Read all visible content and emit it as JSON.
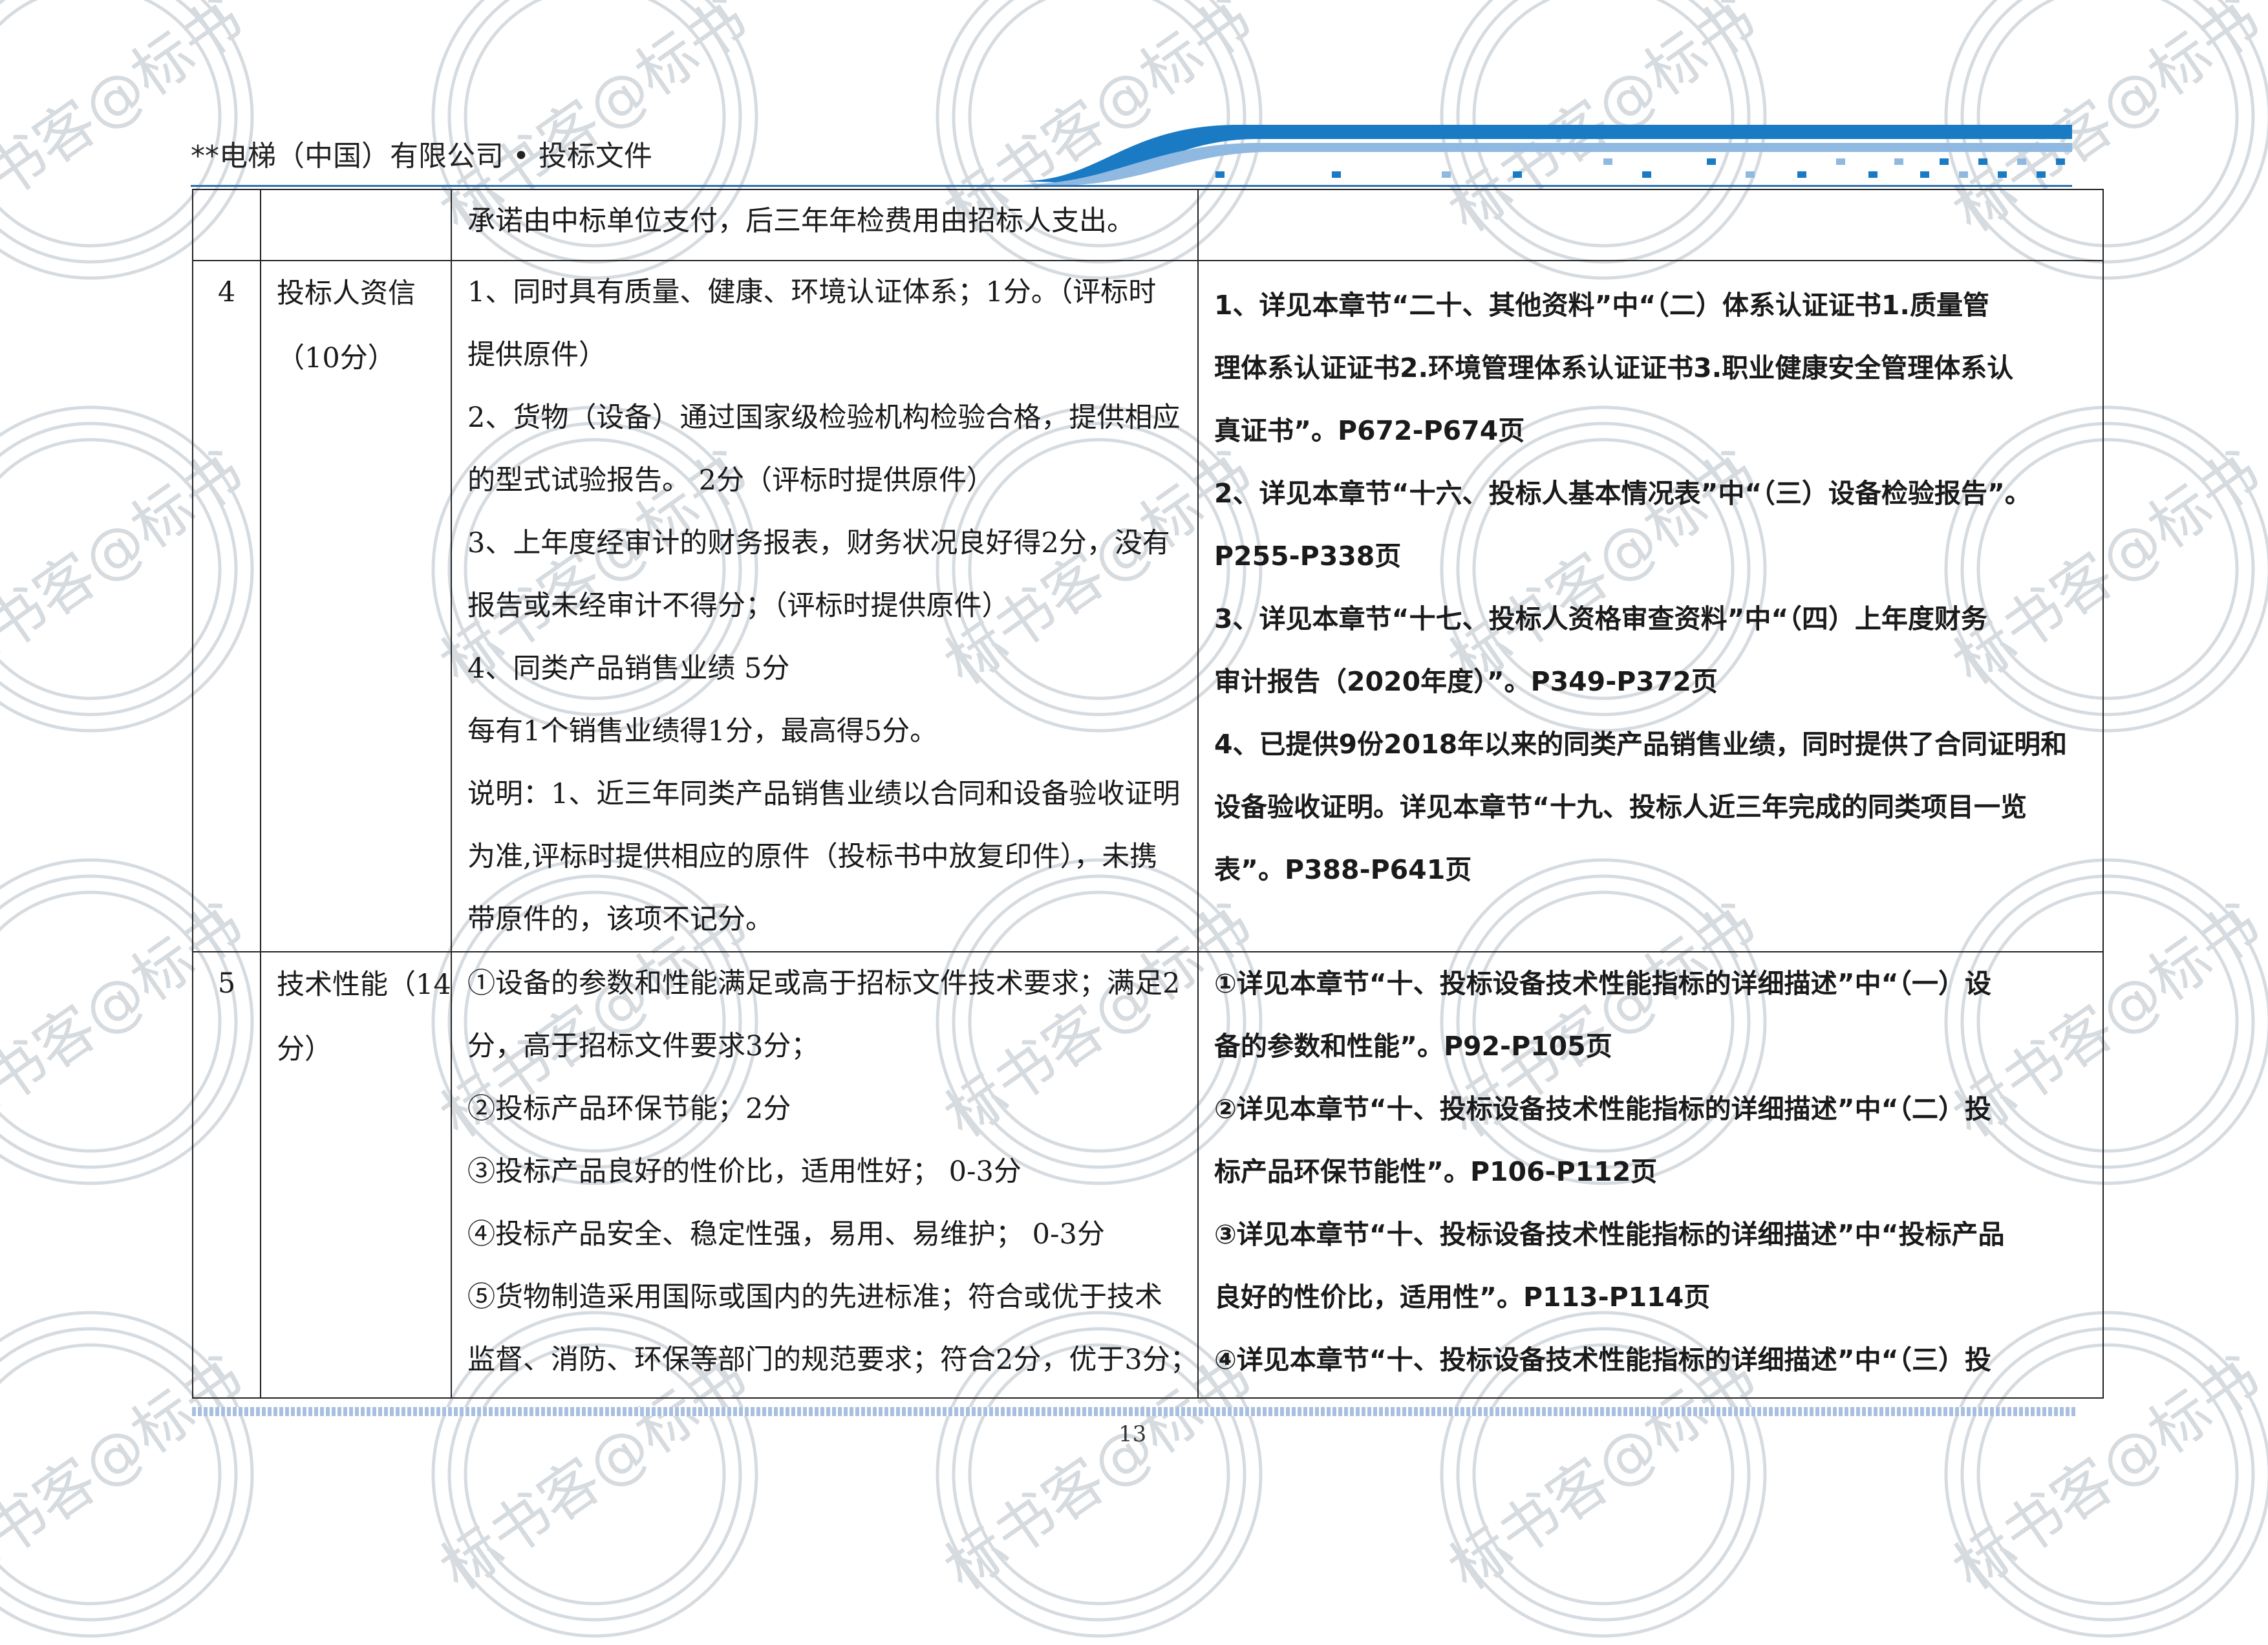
{
  "header": {
    "title": "**电梯（中国）有限公司 • 投标文件"
  },
  "watermark": {
    "text": "标书客@标书",
    "color": "#d6dbe0"
  },
  "colors": {
    "accent": "#1a7bc4",
    "accent_light": "#8fb9e0"
  },
  "table": {
    "rows": [
      {
        "num": "",
        "item": "",
        "criteria": [
          "承诺由中标单位支付，后三年年检费用由招标人支出。"
        ],
        "response": []
      },
      {
        "num": "4",
        "item": [
          "投标人资信",
          "（10分）"
        ],
        "criteria": [
          "1、同时具有质量、健康、环境认证体系；1分。（评标时",
          "提供原件）",
          "2、货物（设备）通过国家级检验机构检验合格，提供相应",
          "的型式试验报告。  2分（评标时提供原件）",
          "3、上年度经审计的财务报表，财务状况良好得2分，没有",
          "报告或未经审计不得分；（评标时提供原件）",
          "4、同类产品销售业绩       5分",
          "每有1个销售业绩得1分，最高得5分。",
          "说明：1、近三年同类产品销售业绩以合同和设备验收证明",
          "为准,评标时提供相应的原件（投标书中放复印件），未携",
          "带原件的，该项不记分。"
        ],
        "response": [
          "1、详见本章节“二十、其他资料”中“（二）体系认证证书1.质量管",
          "理体系认证证书2.环境管理体系认证证书3.职业健康安全管理体系认",
          "真证书”。P672-P674页",
          "2、详见本章节“十六、投标人基本情况表”中“（三）设备检验报告”。",
          "P255-P338页",
          "3、详见本章节“十七、投标人资格审查资料”中“（四）上年度财务",
          "审计报告（2020年度）”。P349-P372页",
          "4、已提供9份2018年以来的同类产品销售业绩，同时提供了合同证明和",
          "设备验收证明。详见本章节“十九、投标人近三年完成的同类项目一览",
          "表”。P388-P641页"
        ]
      },
      {
        "num": "5",
        "item": [
          "技术性能（14",
          "分）"
        ],
        "criteria": [
          "①设备的参数和性能满足或高于招标文件技术要求；满足2",
          "分，高于招标文件要求3分；",
          "②投标产品环保节能；2分",
          "③投标产品良好的性价比，适用性好；              0-3分",
          "④投标产品安全、稳定性强，易用、易维护；  0-3分",
          "⑤货物制造采用国际或国内的先进标准；符合或优于技术",
          "监督、消防、环保等部门的规范要求；符合2分，优于3分；"
        ],
        "response": [
          "①详见本章节“十、投标设备技术性能指标的详细描述”中“（一）设",
          "备的参数和性能”。P92-P105页",
          "②详见本章节“十、投标设备技术性能指标的详细描述”中“（二）投",
          "标产品环保节能性”。P106-P112页",
          "③详见本章节“十、投标设备技术性能指标的详细描述”中“投标产品",
          "良好的性价比，适用性”。P113-P114页",
          "④详见本章节“十、投标设备技术性能指标的详细描述”中“（三）投"
        ]
      }
    ]
  },
  "footer": {
    "page_number": "13"
  }
}
